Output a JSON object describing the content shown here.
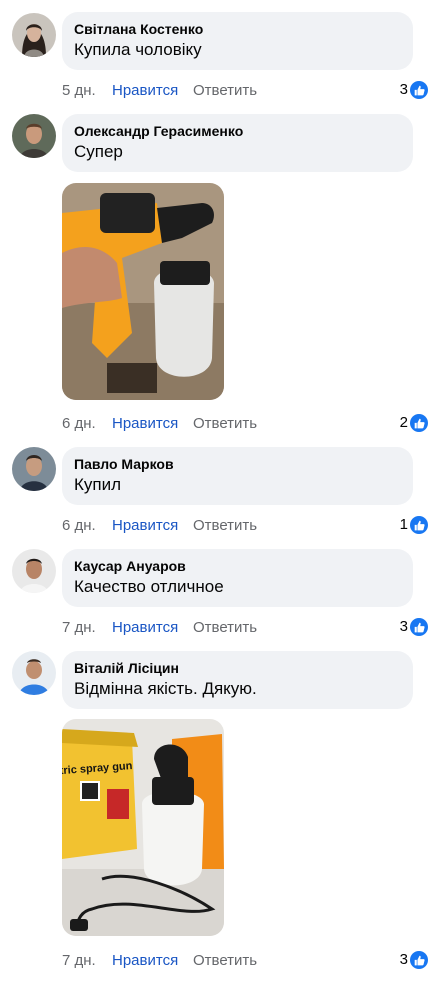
{
  "comments": [
    {
      "author": "Світлана Костенко",
      "text": "Купила чоловіку",
      "time": "5 дн.",
      "like_label": "Нравится",
      "reply_label": "Ответить",
      "reactions": "3"
    },
    {
      "author": "Олександр Герасименко",
      "text": "Супер",
      "time": "6 дн.",
      "like_label": "Нравится",
      "reply_label": "Ответить",
      "reactions": "2"
    },
    {
      "author": "Павло Марков",
      "text": "Купил",
      "time": "6 дн.",
      "like_label": "Нравится",
      "reply_label": "Ответить",
      "reactions": "1"
    },
    {
      "author": "Каусар Ануаров",
      "text": "Качество отличное",
      "time": "7 дн.",
      "like_label": "Нравится",
      "reply_label": "Ответить",
      "reactions": "3"
    },
    {
      "author": "Віталій Лісіцин",
      "text": "Відмінна якість. Дякую.",
      "time": "7 дн.",
      "like_label": "Нравится",
      "reply_label": "Ответить",
      "reactions": "3"
    }
  ],
  "photo_box_text": "tric spray gun",
  "icons": {
    "avatar": "user-photo",
    "like_reaction": "thumbs-up-icon"
  },
  "colors": {
    "bubble": "#f0f2f5",
    "action_link": "#1a56c4",
    "muted": "#65676b",
    "like_badge": "#1877f2"
  }
}
